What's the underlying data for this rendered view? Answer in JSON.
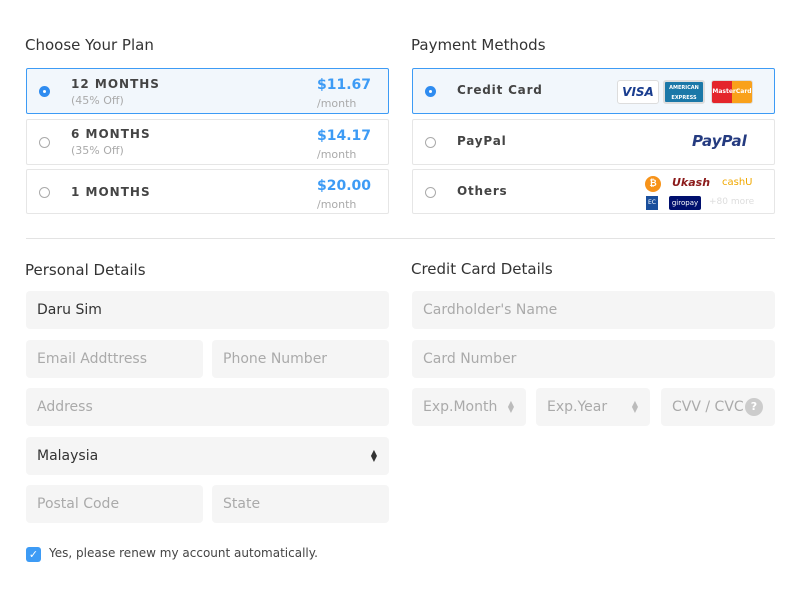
{
  "plan": {
    "title": "Choose Your Plan",
    "options": [
      {
        "name": "12 MONTHS",
        "discount": "(45% Off)",
        "price": "$11.67",
        "per": "/month",
        "selected": true
      },
      {
        "name": "6 MONTHS",
        "discount": "(35% Off)",
        "price": "$14.17",
        "per": "/month",
        "selected": false
      },
      {
        "name": "1 MONTHS",
        "discount": "",
        "price": "$20.00",
        "per": "/month",
        "selected": false
      }
    ]
  },
  "payment": {
    "title": "Payment Methods",
    "options": [
      {
        "name": "Credit Card",
        "selected": true,
        "logos": [
          "VISA",
          "AMERICAN EXPRESS",
          "MasterCard"
        ]
      },
      {
        "name": "PayPal",
        "selected": false,
        "logo": "PayPal"
      },
      {
        "name": "Others",
        "selected": false,
        "logos": [
          "bitcoin",
          "Ukash",
          "cashU",
          "EC",
          "giropay"
        ],
        "more": "+80 more"
      }
    ]
  },
  "personal": {
    "title": "Personal Details",
    "name": "Daru Sim",
    "email_placeholder": "Email Addttress",
    "phone_placeholder": "Phone Number",
    "address_placeholder": "Address",
    "country": "Malaysia",
    "postal_placeholder": "Postal Code",
    "state_placeholder": "State"
  },
  "card": {
    "title": "Credit Card Details",
    "holder_placeholder": "Cardholder's Name",
    "number_placeholder": "Card Number",
    "month_placeholder": "Exp.Month",
    "year_placeholder": "Exp.Year",
    "cvv_placeholder": "CVV / CVC",
    "help": "?"
  },
  "renew": {
    "label": "Yes, please renew my account automatically.",
    "checked": true
  },
  "colors": {
    "accent": "#3d9bf5",
    "field_bg": "#f5f5f5"
  }
}
